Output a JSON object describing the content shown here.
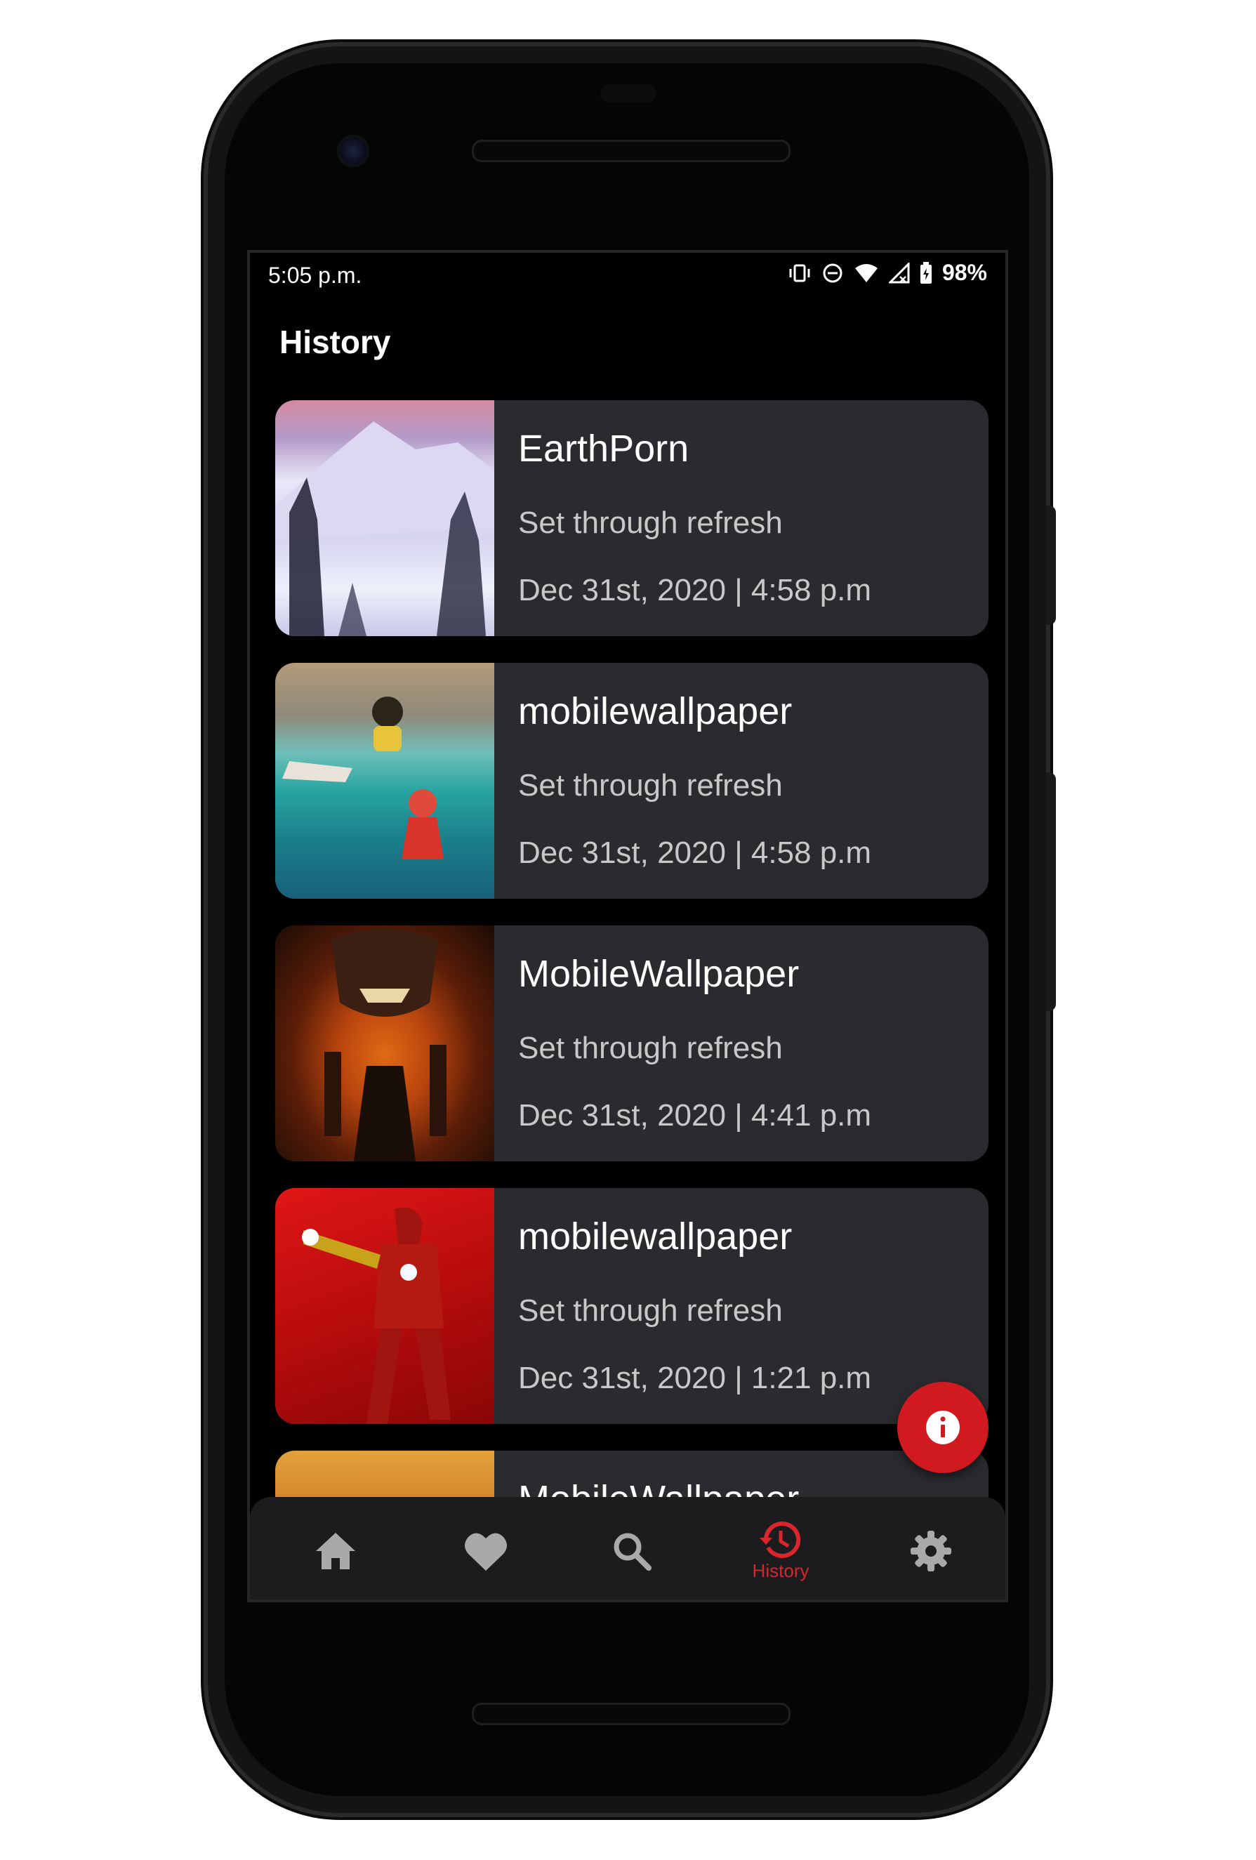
{
  "status_bar": {
    "time": "5:05 p.m.",
    "battery": "98%"
  },
  "header": {
    "title": "History"
  },
  "history": [
    {
      "subreddit": "EarthPorn",
      "method": "Set through refresh",
      "date": "Dec 31st, 2020 | 4:58 p.m"
    },
    {
      "subreddit": "mobilewallpaper",
      "method": "Set through refresh",
      "date": "Dec 31st, 2020 | 4:58 p.m"
    },
    {
      "subreddit": "MobileWallpaper",
      "method": "Set through refresh",
      "date": "Dec 31st, 2020 | 4:41 p.m"
    },
    {
      "subreddit": "mobilewallpaper",
      "method": "Set through refresh",
      "date": "Dec 31st, 2020 | 1:21 p.m"
    },
    {
      "subreddit": "MobileWallpaper"
    }
  ],
  "nav": {
    "items": [
      {
        "icon": "home-icon"
      },
      {
        "icon": "heart-icon"
      },
      {
        "icon": "search-icon"
      },
      {
        "icon": "history-icon",
        "label": "History",
        "active": true
      },
      {
        "icon": "settings-icon"
      }
    ]
  },
  "colors": {
    "accent": "#d01a1f",
    "card": "#2a2b2e",
    "background": "#000000"
  }
}
